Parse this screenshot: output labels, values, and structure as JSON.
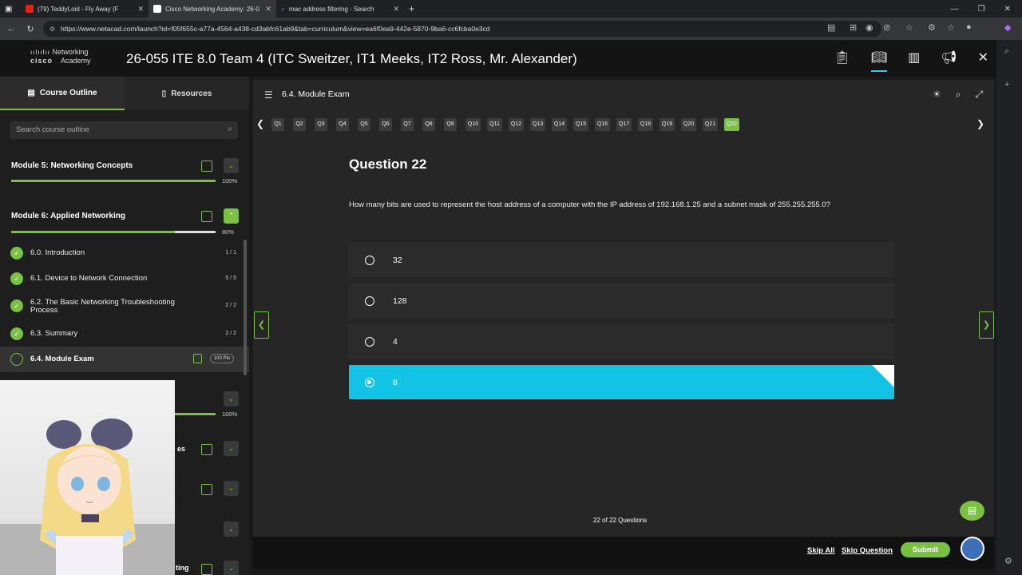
{
  "browser": {
    "tabs": [
      {
        "label": "(79) TeddyLoid - Fly Away (F",
        "color": "#e62117"
      },
      {
        "label": "Cisco Networking Academy: 26-0",
        "color": "#ffffff"
      },
      {
        "label": "mac address filtering - Search",
        "color": "#4285f4"
      }
    ],
    "url": "https://www.netacad.com/launch?id=f05f655c-a77a-4564-a438-cd3abfc61ab9&tab=curriculum&view=ea6f0ea9-442e-5870-9ba6-cc6fcba0e3cd"
  },
  "header": {
    "logo_line1": "Networking",
    "logo_line2": "Academy",
    "logo_brand": "cisco",
    "course_title": "26-055 ITE 8.0 Team 4 (ITC Sweitzer, IT1 Meeks, IT2 Ross, Mr. Alexander)"
  },
  "sidebar": {
    "tab_outline": "Course Outline",
    "tab_resources": "Resources",
    "search_placeholder": "Search course outline",
    "module5": {
      "title": "Module 5: Networking Concepts",
      "percent": "100%",
      "progress": 1.0
    },
    "module6": {
      "title": "Module 6: Applied Networking",
      "percent": "80%",
      "progress": 0.8
    },
    "lessons": [
      {
        "label": "6.0. Introduction",
        "count": "1 / 1"
      },
      {
        "label": "6.1. Device to Network Connection",
        "count": "5 / 5"
      },
      {
        "label": "6.2. The Basic Networking Troubleshooting Process",
        "count": "2 / 2"
      },
      {
        "label": "6.3. Summary",
        "count": "2 / 2"
      },
      {
        "label": "6.4. Module Exam",
        "count": "100 Pts"
      }
    ],
    "module7_percent": "100%",
    "partial_label_1": "es",
    "partial_label_2": "ting"
  },
  "main": {
    "section_title": "6.4. Module Exam",
    "questions": [
      "Q1",
      "Q2",
      "Q3",
      "Q4",
      "Q5",
      "Q6",
      "Q7",
      "Q8",
      "Q9",
      "Q10",
      "Q11",
      "Q12",
      "Q13",
      "Q14",
      "Q15",
      "Q16",
      "Q17",
      "Q18",
      "Q19",
      "Q20",
      "Q21",
      "Q22"
    ],
    "question_title": "Question 22",
    "question_text": "How many bits are used to represent the host address of a computer with the IP address of 192.168.1.25 and a subnet mask of 255.255.255.0?",
    "options": [
      "32",
      "128",
      "4",
      "8"
    ],
    "selected_option": "8",
    "question_count": "22 of 22 Questions"
  },
  "footer": {
    "skip_all": "Skip All",
    "skip_question": "Skip Question",
    "submit": "Submit"
  },
  "colors": {
    "accent_green": "#7ac043",
    "selected_cyan": "#12c3e6"
  }
}
